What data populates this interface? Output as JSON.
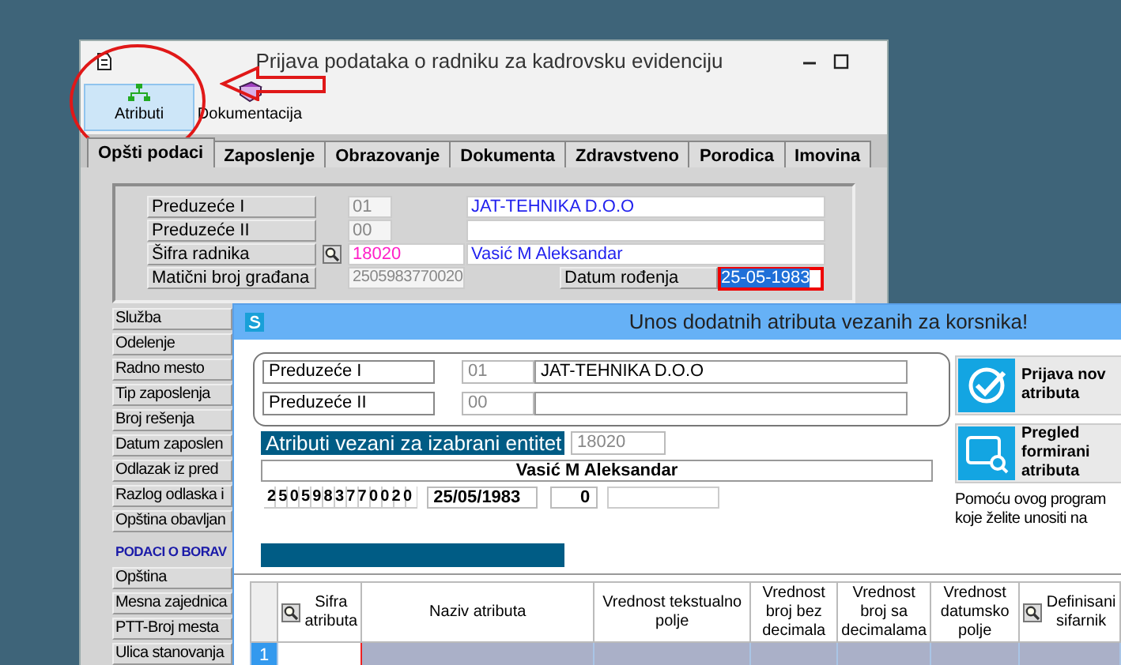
{
  "main_window": {
    "title": "Prijava podataka o radniku za kadrovsku evidenciju",
    "toolbar": [
      {
        "label": "Atributi",
        "kind": "tree",
        "selected": true
      },
      {
        "label": "Dokumentacija",
        "kind": "book",
        "selected": false
      }
    ],
    "tabs": [
      {
        "label": "Opšti podaci",
        "selected": true
      },
      {
        "label": "Zaposlenje",
        "selected": false
      },
      {
        "label": "Obrazovanje",
        "selected": false
      },
      {
        "label": "Dokumenta",
        "selected": false
      },
      {
        "label": "Zdravstveno",
        "selected": false
      },
      {
        "label": "Porodica",
        "selected": false
      },
      {
        "label": "Imovina",
        "selected": false
      }
    ],
    "fields": [
      {
        "label": "Preduzeće I",
        "kind": "plain",
        "code": "01",
        "value": "JAT-TEHNIKA D.O.O"
      },
      {
        "label": "Preduzeće II",
        "kind": "plain",
        "code": "00"
      },
      {
        "label": "Šifra radnika",
        "kind": "lookup",
        "code": "18020",
        "value": "Vasić M Aleksandar"
      },
      {
        "label": "Matični broj građana",
        "kind": "id",
        "code": "2505983770020"
      }
    ],
    "birth_date": {
      "label": "Datum rođenja",
      "value": "25-05-1983",
      "selected": true
    },
    "side_labels": [
      "Služba",
      "Odelenje",
      "Radno mesto",
      "Tip zaposlenja",
      "Broj rešenja",
      "Datum zaposlen",
      "Odlazak iz pred",
      "Razlog odlaska i",
      "Opština obavljan"
    ],
    "section_title": "PODACI O BORAV",
    "residence_labels": [
      "Opština",
      "Mesna zajednica",
      "PTT-Broj mesta",
      "Ulica stanovanja"
    ]
  },
  "dialog": {
    "title": "Unos dodatnih atributa vezanih za korsnika!",
    "fields": [
      {
        "label": "Preduzeće I",
        "code": "01",
        "value": "JAT-TEHNIKA D.O.O"
      },
      {
        "label": "Preduzeće II",
        "code": "00"
      }
    ],
    "entity_label": "Atributi vezani za izabrani entitet",
    "entity_code": "18020",
    "person_name": "Vasić M Aleksandar",
    "jmbg": "2505983770020",
    "birth_date": "25/05/1983",
    "count": "0",
    "buttons": [
      {
        "kind": "check",
        "lines": [
          "Prijava nov",
          "atributa"
        ]
      },
      {
        "kind": "preview",
        "lines": [
          "Pregled",
          "formirani",
          "atributa"
        ]
      }
    ],
    "help_lines": [
      "Pomoću ovog program",
      "koje želite unositi na"
    ],
    "table": {
      "columns": [
        {
          "label": "Sifra atributa",
          "lookup": true
        },
        {
          "label": "Naziv atributa",
          "lookup": false
        },
        {
          "label": "Vrednost tekstualno polje",
          "lookup": false
        },
        {
          "label": "Vrednost broj bez decimala",
          "lookup": false
        },
        {
          "label": "Vrednost broj sa decimalama",
          "lookup": false
        },
        {
          "label": "Vrednost datumsko polje",
          "lookup": false
        },
        {
          "label": "Definisani sifarnik",
          "lookup": true
        }
      ],
      "rows": [
        {
          "number": "1",
          "selected": true
        }
      ]
    }
  }
}
